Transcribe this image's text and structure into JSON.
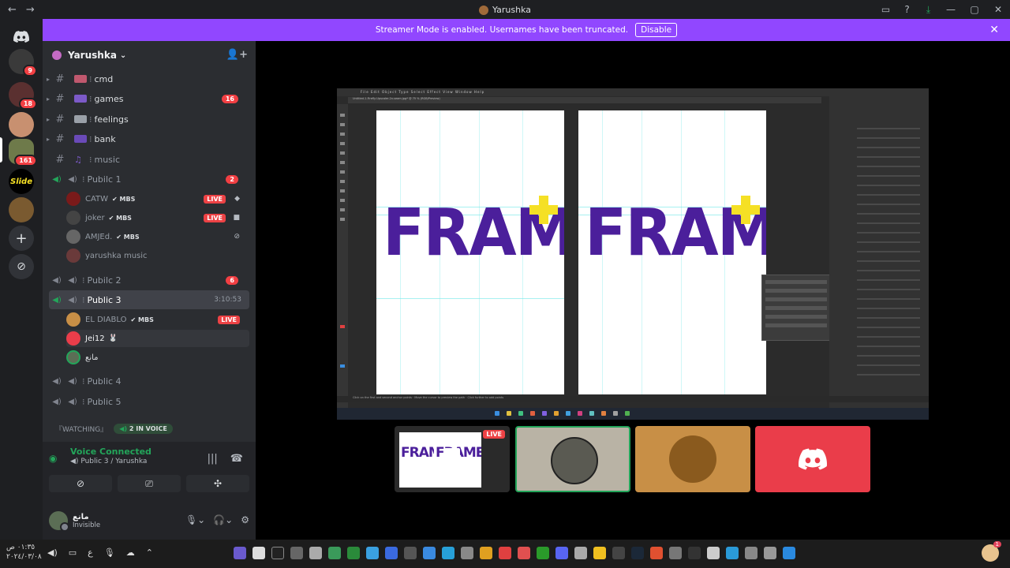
{
  "window": {
    "title": "Yarushka"
  },
  "banner": {
    "text": "Streamer Mode is enabled. Usernames have been truncated.",
    "button": "Disable"
  },
  "rail": {
    "badges": [
      "9",
      "18",
      "161"
    ],
    "slide_label": "Slide"
  },
  "server": {
    "name": "Yarushka"
  },
  "channels": [
    {
      "name": "cmd",
      "badge": ""
    },
    {
      "name": "games",
      "badge": "16"
    },
    {
      "name": "feelings",
      "badge": ""
    },
    {
      "name": "bank",
      "badge": ""
    },
    {
      "name": "music",
      "badge": ""
    }
  ],
  "voice": {
    "public1": {
      "name": "Pubilc 1",
      "badge": "2"
    },
    "public1_users": [
      {
        "name": "CATW",
        "tag": "MBS",
        "live": "LIVE"
      },
      {
        "name": "joker",
        "tag": "MBS",
        "live": "LIVE"
      },
      {
        "name": "AMJEd.",
        "tag": "MBS",
        "live": ""
      },
      {
        "name": "yarushka music",
        "tag": "",
        "live": ""
      }
    ],
    "public2": {
      "name": "Pubilc 2",
      "badge": "6"
    },
    "public3": {
      "name": "Public 3",
      "timer": "3:10:53"
    },
    "public3_users": [
      {
        "name": "EL DIABLO",
        "tag": "MBS",
        "live": "LIVE"
      },
      {
        "name": "Jei12",
        "tag": "",
        "live": ""
      },
      {
        "name": "مانع",
        "tag": "",
        "live": ""
      }
    ],
    "public4": {
      "name": "Public 4"
    },
    "public5": {
      "name": "Public 5"
    }
  },
  "watching": {
    "label": "『WATCHING』",
    "pill": "2 IN VOICE"
  },
  "voice_panel": {
    "status": "Voice Connected",
    "location": "Public 3 / Yarushka"
  },
  "user_panel": {
    "name": "مانع",
    "status": "Invisible"
  },
  "stream": {
    "live_badge": "LIVE",
    "artboard_word": "FRAME",
    "mini_word": "FRAME",
    "illustrator_menu": "File  Edit  Object  Type  Select  Effect  View  Window  Help",
    "illustrator_tab": "Untitled-1-Firefly-Upscaler-2x-seam.jpg* @ 75 % (RGB/Preview)",
    "illustrator_status": "Click on the first and second anchor points · Move the cursor to preview the path · Click further to add points"
  },
  "colors": {
    "banner": "#9147ff",
    "frame_purple": "#4b1f9b",
    "plus_yellow": "#f5e025",
    "live_red": "#ed4245",
    "connected_green": "#23a55a"
  },
  "taskbar": {
    "time": "٠١:٣٥ ص",
    "date": "٢٠٢٤/٠٣/٠٨",
    "lang": "ع"
  }
}
